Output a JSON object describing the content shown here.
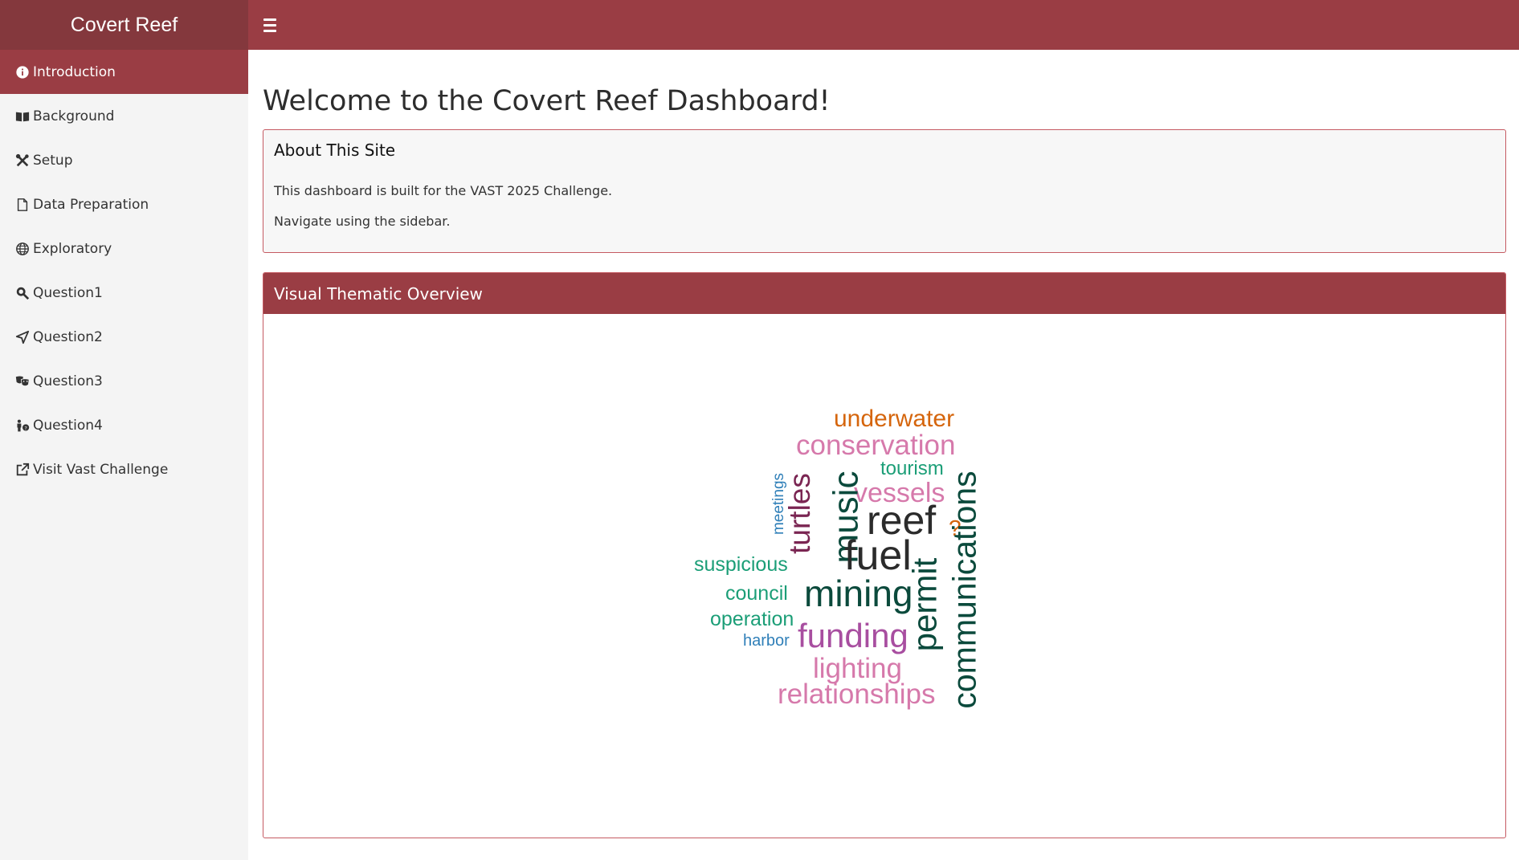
{
  "app": {
    "title": "Covert Reef"
  },
  "sidebar": {
    "items": [
      {
        "label": "Introduction",
        "icon": "info-circle-icon"
      },
      {
        "label": "Background",
        "icon": "book-open-icon"
      },
      {
        "label": "Setup",
        "icon": "tools-icon"
      },
      {
        "label": "Data Preparation",
        "icon": "file-icon"
      },
      {
        "label": "Exploratory",
        "icon": "globe-icon"
      },
      {
        "label": "Question1",
        "icon": "search-magnify-icon"
      },
      {
        "label": "Question2",
        "icon": "location-arrow-icon"
      },
      {
        "label": "Question3",
        "icon": "theater-masks-icon"
      },
      {
        "label": "Question4",
        "icon": "person-question-icon"
      },
      {
        "label": "Visit Vast Challenge",
        "icon": "external-link-icon"
      }
    ]
  },
  "main": {
    "title": "Welcome to the Covert Reef Dashboard!",
    "about": {
      "title": "About This Site",
      "line1": "This dashboard is built for the VAST 2025 Challenge.",
      "line2": "Navigate using the sidebar."
    },
    "wordcloud": {
      "title": "Visual Thematic Overview",
      "colors": {
        "dark": "#2b2b2b",
        "darkgreen": "#0b4a3c",
        "teal": "#1b9e77",
        "pink": "#d679ab",
        "magenta": "#a84ea0",
        "plum": "#7a2552",
        "orange": "#d5650c",
        "blue": "#2f7fb8"
      },
      "words": {
        "underwater": "underwater",
        "conservation": "conservation",
        "tourism": "tourism",
        "meetings": "meetings",
        "vessels": "vessels",
        "turtles": "turtles",
        "music": "music",
        "reef": "reef",
        "question": "?",
        "suspicious": "suspicious",
        "fuel": "fuel",
        "council": "council",
        "mining": "mining",
        "operation": "operation",
        "permit": "permit",
        "communications": "communications",
        "harbor": "harbor",
        "funding": "funding",
        "lighting": "lighting",
        "relationships": "relationships"
      }
    }
  }
}
